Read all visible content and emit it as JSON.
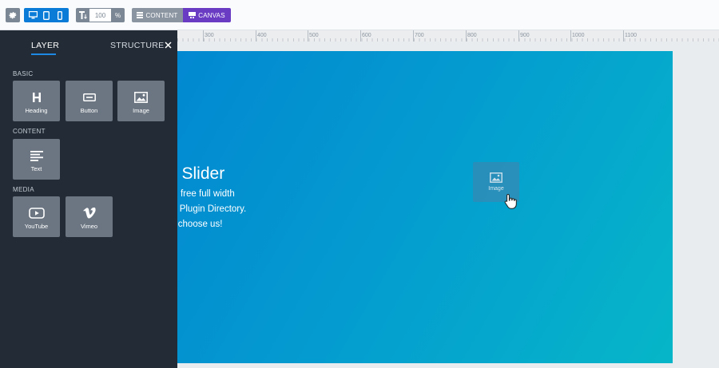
{
  "toolbar": {
    "font_size_value": "100",
    "font_size_unit": "%",
    "content_label": "CONTENT",
    "canvas_label": "CANVAS",
    "accent_blue": "#0a7cd8",
    "accent_purple": "#6a3cc4"
  },
  "ruler": {
    "labels": [
      "300",
      "400",
      "500",
      "600",
      "700",
      "800",
      "900",
      "1000",
      "1100"
    ]
  },
  "panel": {
    "tabs": {
      "layer": "LAYER",
      "structure": "STRUCTURE"
    },
    "close_icon": "close-icon",
    "sections": {
      "basic": {
        "title": "BASIC",
        "items": [
          {
            "label": "Heading",
            "icon": "heading-icon"
          },
          {
            "label": "Button",
            "icon": "button-icon"
          },
          {
            "label": "Image",
            "icon": "image-icon"
          }
        ]
      },
      "content": {
        "title": "CONTENT",
        "items": [
          {
            "label": "Text",
            "icon": "text-icon"
          }
        ]
      },
      "media": {
        "title": "MEDIA",
        "items": [
          {
            "label": "YouTube",
            "icon": "youtube-icon"
          },
          {
            "label": "Vimeo",
            "icon": "vimeo-icon"
          }
        ]
      }
    }
  },
  "slide": {
    "title": "n Slider",
    "lines": [
      "ed free full width",
      "ss Plugin Directory.",
      "rs choose us!"
    ],
    "gradient_start": "#0288d1",
    "gradient_end": "#06b6c8"
  },
  "drag_ghost": {
    "label": "Image"
  }
}
